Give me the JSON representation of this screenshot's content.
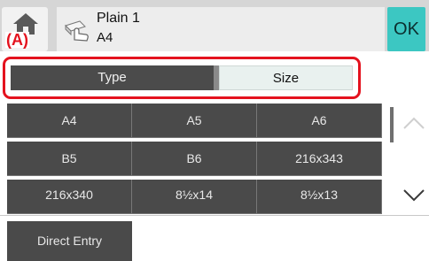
{
  "header": {
    "annotation_label": "(A)",
    "paper_type": "Plain 1",
    "paper_size": "A4",
    "ok_label": "OK"
  },
  "tabs": [
    {
      "label": "Type",
      "selected": false
    },
    {
      "label": "Size",
      "selected": true
    }
  ],
  "sizes": [
    "A4",
    "A5",
    "A6",
    "B5",
    "B6",
    "216x343",
    "216x340",
    "8½x14",
    "8½x13"
  ],
  "footer": {
    "direct_entry_label": "Direct Entry"
  },
  "icons": {
    "home": "home-icon",
    "paper": "hand-paper-icon",
    "scroll_up": "chevron-up-icon",
    "scroll_down": "chevron-down-icon"
  },
  "colors": {
    "accent": "#3cc7c2",
    "highlight": "#e4121e",
    "button_dark": "#4a4a4a"
  }
}
